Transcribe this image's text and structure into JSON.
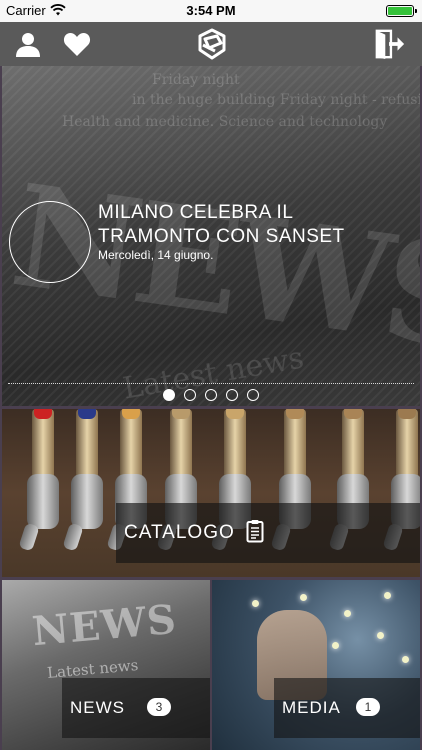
{
  "status_bar": {
    "carrier": "Carrier",
    "time": "3:54 PM",
    "battery_level": 1.0,
    "battery_color": "#35c23a"
  },
  "nav_bar": {
    "icons": [
      "user-icon",
      "heart-icon",
      "app-logo-icon",
      "exit-icon"
    ],
    "background": "#5a5a5a"
  },
  "hero": {
    "title": "MILANO CELEBRA IL TRAMONTO CON SANSET",
    "date": "Mercoledì, 14 giugno.",
    "page_count": 5,
    "active_page": 1,
    "background_word": "NEWS",
    "background_sub": "Latest news",
    "background_lines": [
      "Friday night",
      "in the huge building Friday night - refusing",
      "Health and medicine. Science and technology"
    ]
  },
  "catalogo": {
    "label": "CATALOGO",
    "icon": "clipboard-icon"
  },
  "tiles": {
    "news": {
      "label": "NEWS",
      "badge": "3",
      "background_word": "NEWS",
      "background_sub": "Latest news"
    },
    "media": {
      "label": "MEDIA",
      "badge": "1"
    }
  }
}
